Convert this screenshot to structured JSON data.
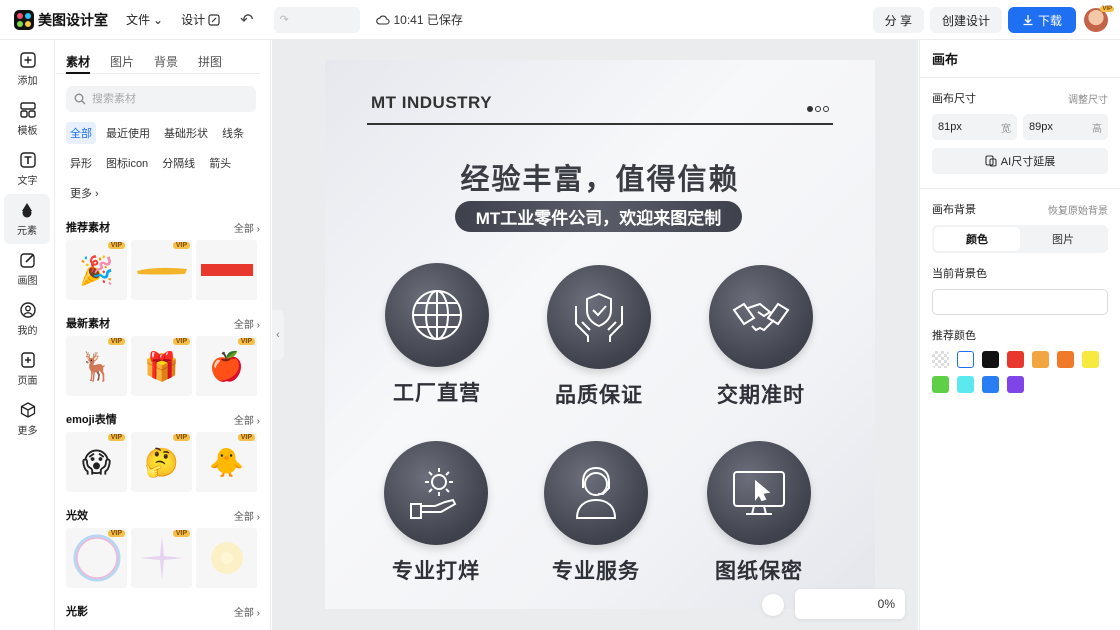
{
  "topbar": {
    "app_name": "美图设计室",
    "menu_file": "文件",
    "menu_design": "设计",
    "save_status": "10:41 已保存",
    "share": "分 享",
    "create_design": "创建设计",
    "download": "下载",
    "avatar_badge": "VIP"
  },
  "rail": {
    "items": [
      {
        "label": "添加",
        "icon": "plus-square-icon"
      },
      {
        "label": "模板",
        "icon": "template-icon"
      },
      {
        "label": "文字",
        "icon": "text-icon"
      },
      {
        "label": "元素",
        "icon": "shapes-icon"
      },
      {
        "label": "画图",
        "icon": "draw-icon"
      },
      {
        "label": "我的",
        "icon": "user-icon"
      },
      {
        "label": "页面",
        "icon": "page-add-icon"
      },
      {
        "label": "更多",
        "icon": "cube-icon"
      }
    ]
  },
  "panel": {
    "tabs": [
      "素材",
      "图片",
      "背景",
      "拼图"
    ],
    "search_placeholder": "搜索素材",
    "chips": [
      "全部",
      "最近使用",
      "基础形状",
      "线条",
      "异形",
      "图标icon",
      "分隔线",
      "箭头",
      "更多"
    ],
    "more_label": "全部",
    "vip": "VIP",
    "sections": [
      {
        "title": "推荐素材"
      },
      {
        "title": "最新素材"
      },
      {
        "title": "emoji表情"
      },
      {
        "title": "光效"
      },
      {
        "title": "光影"
      }
    ]
  },
  "artboard": {
    "brand": "MT INDUSTRY",
    "headline": "经验丰富，值得信赖",
    "tagline": "MT工业零件公司，欢迎来图定制",
    "features": [
      {
        "label": "工厂直营",
        "icon": "globe-icon"
      },
      {
        "label": "品质保证",
        "icon": "shield-hands-icon"
      },
      {
        "label": "交期准时",
        "icon": "handshake-icon"
      },
      {
        "label": "专业打烊",
        "icon": "gear-hand-icon"
      },
      {
        "label": "专业服务",
        "icon": "agent-headset-icon"
      },
      {
        "label": "图纸保密",
        "icon": "monitor-cursor-icon"
      }
    ],
    "zoom": "0%"
  },
  "props": {
    "title": "画布",
    "size_label": "画布尺寸",
    "size_link": "调整尺寸",
    "width_value": "81px",
    "width_unit": "宽",
    "height_value": "89px",
    "height_unit": "高",
    "ai_extend": "AI尺寸延展",
    "bg_label": "画布背景",
    "bg_link": "恢复原始背景",
    "seg_color": "颜色",
    "seg_image": "图片",
    "current_bg": "当前背景色",
    "recommended": "推荐颜色",
    "swatches": [
      "transparent",
      "#ffffff",
      "#111111",
      "#e8372c",
      "#f2a540",
      "#f07a2a",
      "#f6ea3f",
      "#5fcf48",
      "#5ce8ef",
      "#2a7ef3",
      "#7f45e8"
    ]
  }
}
